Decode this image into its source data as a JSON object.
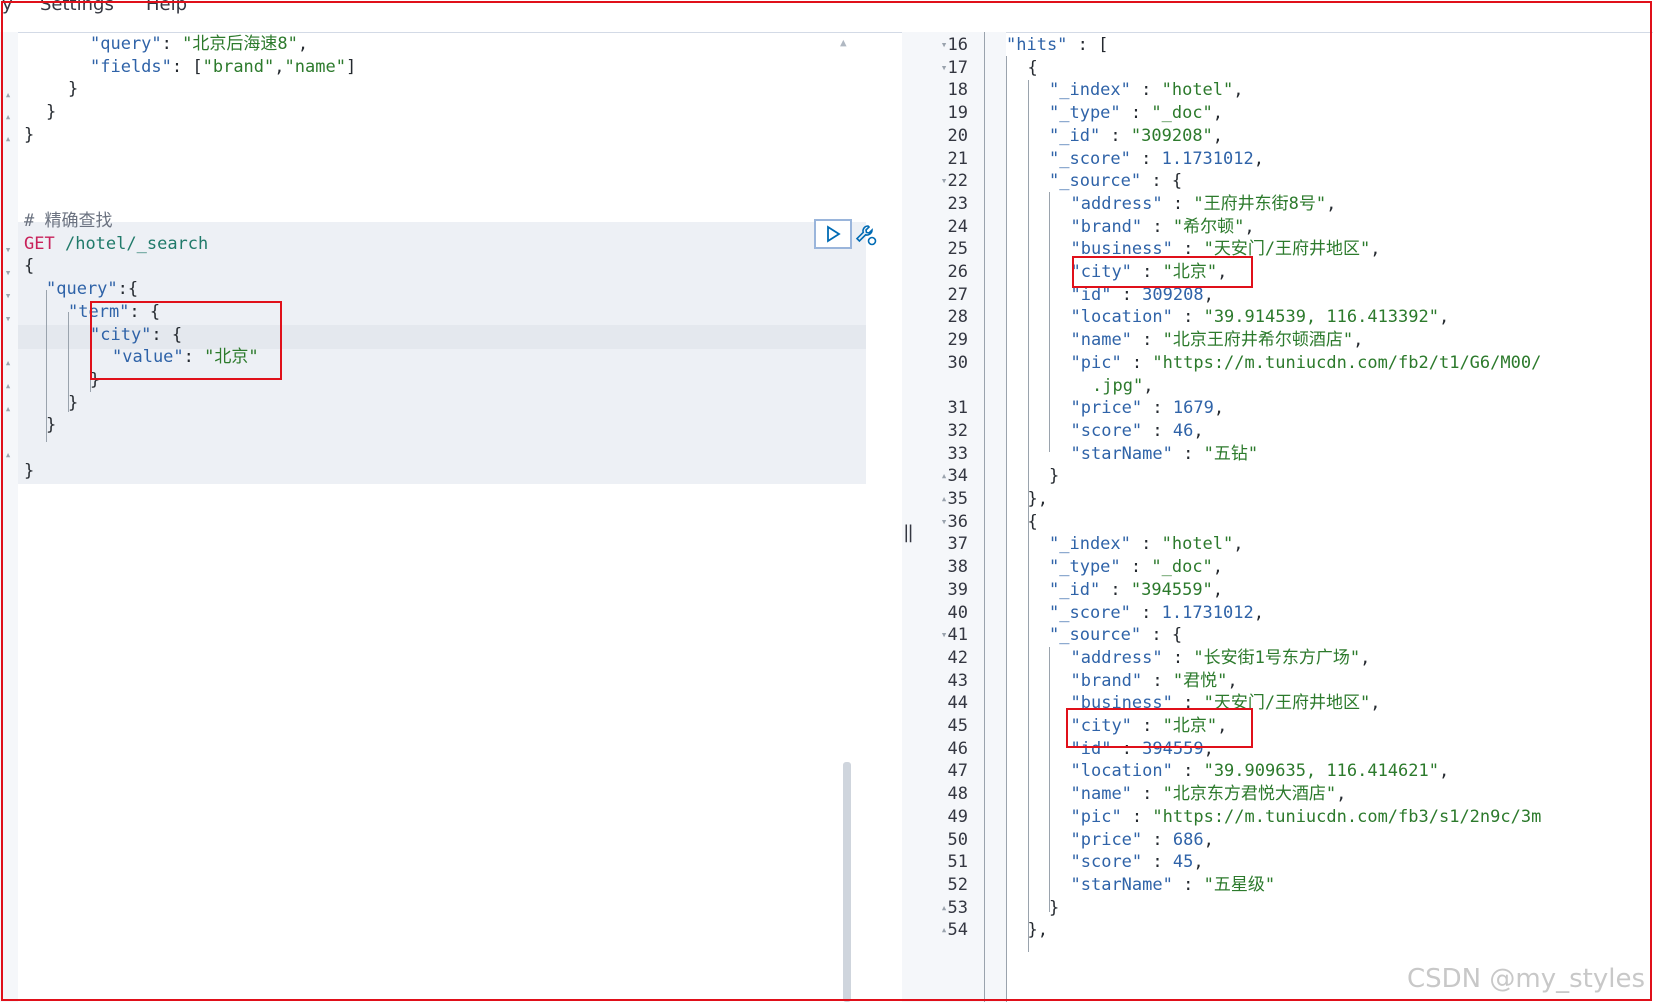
{
  "menu": {
    "items": [
      "y",
      "Settings",
      "Help"
    ]
  },
  "left_editor": {
    "top_lines": [
      {
        "indent": 3,
        "parts": [
          [
            "k",
            "\"query\""
          ],
          [
            "p",
            ": "
          ],
          [
            "s",
            "\"北京后海速8\""
          ],
          [
            "p",
            ","
          ]
        ]
      },
      {
        "indent": 3,
        "parts": [
          [
            "k",
            "\"fields\""
          ],
          [
            "p",
            ": ["
          ],
          [
            "s",
            "\"brand\""
          ],
          [
            "p",
            ","
          ],
          [
            "s",
            "\"name\""
          ],
          [
            "p",
            "]"
          ]
        ]
      },
      {
        "indent": 2,
        "parts": [
          [
            "p",
            "}"
          ]
        ]
      },
      {
        "indent": 1,
        "parts": [
          [
            "p",
            "}"
          ]
        ]
      },
      {
        "indent": 0,
        "parts": [
          [
            "p",
            "}"
          ]
        ]
      }
    ],
    "comment": "# 精确查找",
    "request_method": "GET",
    "request_path": "/hotel/_search",
    "body_lines": [
      {
        "indent": 0,
        "parts": [
          [
            "p",
            "{"
          ]
        ]
      },
      {
        "indent": 1,
        "parts": [
          [
            "k",
            "\"query\""
          ],
          [
            "p",
            ":{"
          ]
        ]
      },
      {
        "indent": 2,
        "parts": [
          [
            "k",
            "\"term\""
          ],
          [
            "p",
            ": {"
          ]
        ]
      },
      {
        "indent": 3,
        "parts": [
          [
            "k",
            "\"city\""
          ],
          [
            "p",
            ": {"
          ]
        ]
      },
      {
        "indent": 4,
        "parts": [
          [
            "k",
            "\"value\""
          ],
          [
            "p",
            ": "
          ],
          [
            "s",
            "\"北京\""
          ]
        ]
      },
      {
        "indent": 3,
        "parts": [
          [
            "p",
            "}"
          ]
        ]
      },
      {
        "indent": 2,
        "parts": [
          [
            "p",
            "}"
          ]
        ]
      },
      {
        "indent": 1,
        "parts": [
          [
            "p",
            "}"
          ]
        ]
      },
      {
        "indent": 0,
        "parts": [
          [
            "p",
            ""
          ]
        ]
      },
      {
        "indent": 0,
        "parts": [
          [
            "p",
            "}"
          ]
        ]
      }
    ],
    "run_icon": "play-icon",
    "settings_icon": "wrench-icon"
  },
  "right_editor": {
    "lines": [
      {
        "n": 16,
        "fold": "down",
        "indent": 1,
        "parts": [
          [
            "k",
            "\"hits\""
          ],
          [
            "p",
            " : ["
          ]
        ]
      },
      {
        "n": 17,
        "fold": "down",
        "indent": 2,
        "parts": [
          [
            "p",
            "{"
          ]
        ]
      },
      {
        "n": 18,
        "indent": 3,
        "parts": [
          [
            "k",
            "\"_index\""
          ],
          [
            "p",
            " : "
          ],
          [
            "s",
            "\"hotel\""
          ],
          [
            "p",
            ","
          ]
        ]
      },
      {
        "n": 19,
        "indent": 3,
        "parts": [
          [
            "k",
            "\"_type\""
          ],
          [
            "p",
            " : "
          ],
          [
            "s",
            "\"_doc\""
          ],
          [
            "p",
            ","
          ]
        ]
      },
      {
        "n": 20,
        "indent": 3,
        "parts": [
          [
            "k",
            "\"_id\""
          ],
          [
            "p",
            " : "
          ],
          [
            "s",
            "\"309208\""
          ],
          [
            "p",
            ","
          ]
        ]
      },
      {
        "n": 21,
        "indent": 3,
        "parts": [
          [
            "k",
            "\"_score\""
          ],
          [
            "p",
            " : "
          ],
          [
            "n",
            "1.1731012"
          ],
          [
            "p",
            ","
          ]
        ]
      },
      {
        "n": 22,
        "fold": "down",
        "indent": 3,
        "parts": [
          [
            "k",
            "\"_source\""
          ],
          [
            "p",
            " : {"
          ]
        ]
      },
      {
        "n": 23,
        "indent": 4,
        "parts": [
          [
            "k",
            "\"address\""
          ],
          [
            "p",
            " : "
          ],
          [
            "s",
            "\"王府井东街8号\""
          ],
          [
            "p",
            ","
          ]
        ]
      },
      {
        "n": 24,
        "indent": 4,
        "parts": [
          [
            "k",
            "\"brand\""
          ],
          [
            "p",
            " : "
          ],
          [
            "s",
            "\"希尔顿\""
          ],
          [
            "p",
            ","
          ]
        ]
      },
      {
        "n": 25,
        "indent": 4,
        "parts": [
          [
            "k",
            "\"business\""
          ],
          [
            "p",
            " : "
          ],
          [
            "s",
            "\"天安门/王府井地区\""
          ],
          [
            "p",
            ","
          ]
        ]
      },
      {
        "n": 26,
        "indent": 4,
        "parts": [
          [
            "k",
            "\"city\""
          ],
          [
            "p",
            " : "
          ],
          [
            "s",
            "\"北京\""
          ],
          [
            "p",
            ","
          ]
        ]
      },
      {
        "n": 27,
        "indent": 4,
        "parts": [
          [
            "k",
            "\"id\""
          ],
          [
            "p",
            " : "
          ],
          [
            "n",
            "309208"
          ],
          [
            "p",
            ","
          ]
        ]
      },
      {
        "n": 28,
        "indent": 4,
        "parts": [
          [
            "k",
            "\"location\""
          ],
          [
            "p",
            " : "
          ],
          [
            "s",
            "\"39.914539, 116.413392\""
          ],
          [
            "p",
            ","
          ]
        ]
      },
      {
        "n": 29,
        "indent": 4,
        "parts": [
          [
            "k",
            "\"name\""
          ],
          [
            "p",
            " : "
          ],
          [
            "s",
            "\"北京王府井希尔顿酒店\""
          ],
          [
            "p",
            ","
          ]
        ]
      },
      {
        "n": 30,
        "indent": 4,
        "parts": [
          [
            "k",
            "\"pic\""
          ],
          [
            "p",
            " : "
          ],
          [
            "s",
            "\"https://m.tuniucdn.com/fb2/t1/G6/M00/"
          ]
        ]
      },
      {
        "n": "",
        "indent": 5,
        "parts": [
          [
            "s",
            ".jpg\""
          ],
          [
            "p",
            ","
          ]
        ]
      },
      {
        "n": 31,
        "indent": 4,
        "parts": [
          [
            "k",
            "\"price\""
          ],
          [
            "p",
            " : "
          ],
          [
            "n",
            "1679"
          ],
          [
            "p",
            ","
          ]
        ]
      },
      {
        "n": 32,
        "indent": 4,
        "parts": [
          [
            "k",
            "\"score\""
          ],
          [
            "p",
            " : "
          ],
          [
            "n",
            "46"
          ],
          [
            "p",
            ","
          ]
        ]
      },
      {
        "n": 33,
        "indent": 4,
        "parts": [
          [
            "k",
            "\"starName\""
          ],
          [
            "p",
            " : "
          ],
          [
            "s",
            "\"五钻\""
          ]
        ]
      },
      {
        "n": 34,
        "fold": "up",
        "indent": 3,
        "parts": [
          [
            "p",
            "}"
          ]
        ]
      },
      {
        "n": 35,
        "fold": "up",
        "indent": 2,
        "parts": [
          [
            "p",
            "},"
          ]
        ]
      },
      {
        "n": 36,
        "fold": "down",
        "indent": 2,
        "parts": [
          [
            "p",
            "{"
          ]
        ]
      },
      {
        "n": 37,
        "indent": 3,
        "parts": [
          [
            "k",
            "\"_index\""
          ],
          [
            "p",
            " : "
          ],
          [
            "s",
            "\"hotel\""
          ],
          [
            "p",
            ","
          ]
        ]
      },
      {
        "n": 38,
        "indent": 3,
        "parts": [
          [
            "k",
            "\"_type\""
          ],
          [
            "p",
            " : "
          ],
          [
            "s",
            "\"_doc\""
          ],
          [
            "p",
            ","
          ]
        ]
      },
      {
        "n": 39,
        "indent": 3,
        "parts": [
          [
            "k",
            "\"_id\""
          ],
          [
            "p",
            " : "
          ],
          [
            "s",
            "\"394559\""
          ],
          [
            "p",
            ","
          ]
        ]
      },
      {
        "n": 40,
        "indent": 3,
        "parts": [
          [
            "k",
            "\"_score\""
          ],
          [
            "p",
            " : "
          ],
          [
            "n",
            "1.1731012"
          ],
          [
            "p",
            ","
          ]
        ]
      },
      {
        "n": 41,
        "fold": "down",
        "indent": 3,
        "parts": [
          [
            "k",
            "\"_source\""
          ],
          [
            "p",
            " : {"
          ]
        ]
      },
      {
        "n": 42,
        "indent": 4,
        "parts": [
          [
            "k",
            "\"address\""
          ],
          [
            "p",
            " : "
          ],
          [
            "s",
            "\"长安街1号东方广场\""
          ],
          [
            "p",
            ","
          ]
        ]
      },
      {
        "n": 43,
        "indent": 4,
        "parts": [
          [
            "k",
            "\"brand\""
          ],
          [
            "p",
            " : "
          ],
          [
            "s",
            "\"君悦\""
          ],
          [
            "p",
            ","
          ]
        ]
      },
      {
        "n": 44,
        "indent": 4,
        "parts": [
          [
            "k",
            "\"business\""
          ],
          [
            "p",
            " : "
          ],
          [
            "s",
            "\"天安门/王府井地区\""
          ],
          [
            "p",
            ","
          ]
        ]
      },
      {
        "n": 45,
        "indent": 4,
        "parts": [
          [
            "k",
            "\"city\""
          ],
          [
            "p",
            " : "
          ],
          [
            "s",
            "\"北京\""
          ],
          [
            "p",
            ","
          ]
        ]
      },
      {
        "n": 46,
        "indent": 4,
        "parts": [
          [
            "k",
            "\"id\""
          ],
          [
            "p",
            " : "
          ],
          [
            "n",
            "394559"
          ],
          [
            "p",
            ","
          ]
        ]
      },
      {
        "n": 47,
        "indent": 4,
        "parts": [
          [
            "k",
            "\"location\""
          ],
          [
            "p",
            " : "
          ],
          [
            "s",
            "\"39.909635, 116.414621\""
          ],
          [
            "p",
            ","
          ]
        ]
      },
      {
        "n": 48,
        "indent": 4,
        "parts": [
          [
            "k",
            "\"name\""
          ],
          [
            "p",
            " : "
          ],
          [
            "s",
            "\"北京东方君悦大酒店\""
          ],
          [
            "p",
            ","
          ]
        ]
      },
      {
        "n": 49,
        "indent": 4,
        "parts": [
          [
            "k",
            "\"pic\""
          ],
          [
            "p",
            " : "
          ],
          [
            "s",
            "\"https://m.tuniucdn.com/fb3/s1/2n9c/3m"
          ]
        ]
      },
      {
        "n": 50,
        "indent": 4,
        "parts": [
          [
            "k",
            "\"price\""
          ],
          [
            "p",
            " : "
          ],
          [
            "n",
            "686"
          ],
          [
            "p",
            ","
          ]
        ]
      },
      {
        "n": 51,
        "indent": 4,
        "parts": [
          [
            "k",
            "\"score\""
          ],
          [
            "p",
            " : "
          ],
          [
            "n",
            "45"
          ],
          [
            "p",
            ","
          ]
        ]
      },
      {
        "n": 52,
        "indent": 4,
        "parts": [
          [
            "k",
            "\"starName\""
          ],
          [
            "p",
            " : "
          ],
          [
            "s",
            "\"五星级\""
          ]
        ]
      },
      {
        "n": 53,
        "fold": "up",
        "indent": 3,
        "parts": [
          [
            "p",
            "}"
          ]
        ]
      },
      {
        "n": 54,
        "fold": "up",
        "indent": 2,
        "parts": [
          [
            "p",
            "},"
          ]
        ]
      }
    ]
  },
  "resize_handle": "‖",
  "watermark": "CSDN @my_styles"
}
